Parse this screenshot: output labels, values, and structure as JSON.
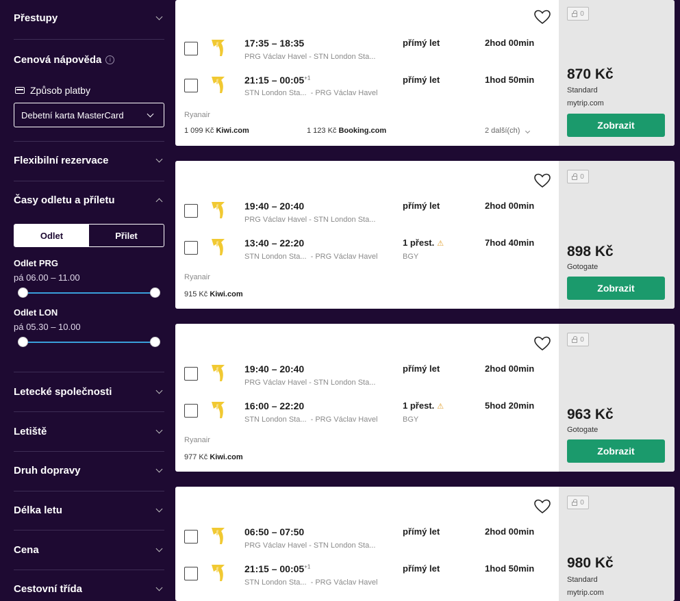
{
  "sidebar": {
    "prestupy": "Přestupy",
    "cenova_napoveda": "Cenová nápověda",
    "info": "i",
    "zpusob_platby": "Způsob platby",
    "payment_value": "Debetní karta MasterCard",
    "flexibilni": "Flexibilní rezervace",
    "casy": "Časy odletu a příletu",
    "toggle_odlet": "Odlet",
    "toggle_prilet": "Přilet",
    "odlet_prg_label": "Odlet PRG",
    "odlet_prg_value": "pá 06.00 – 11.00",
    "odlet_lon_label": "Odlet LON",
    "odlet_lon_value": "pá 05.30 – 10.00",
    "letecke": "Letecké společnosti",
    "letiste": "Letiště",
    "druh": "Druh dopravy",
    "delka": "Délka letu",
    "cena": "Cena",
    "trida": "Cestovní třída"
  },
  "cards": [
    {
      "legs": [
        {
          "times": "17:35 – 18:35",
          "plus": "",
          "from": "PRG Václav Havel",
          "to": "STN London Sta...",
          "stops": "přímý let",
          "via": "",
          "duration": "2hod 00min"
        },
        {
          "times": "21:15 – 00:05",
          "plus": "+1",
          "from": "STN London Sta...",
          "to": "PRG Václav Havel",
          "stops": "přímý let",
          "via": "",
          "duration": "1hod 50min"
        }
      ],
      "airline": "Ryanair",
      "alt1_price": "1 099 Kč",
      "alt1_site": "Kiwi.com",
      "alt2_price": "1 123 Kč",
      "alt2_site": "Booking.com",
      "more": "2 další(ch)",
      "lock": "0",
      "price": "870 Kč",
      "fare": "Standard",
      "provider": "mytrip.com",
      "button": "Zobrazit"
    },
    {
      "legs": [
        {
          "times": "19:40 – 20:40",
          "plus": "",
          "from": "PRG Václav Havel",
          "to": "STN London Sta...",
          "stops": "přímý let",
          "via": "",
          "duration": "2hod 00min"
        },
        {
          "times": "13:40 – 22:20",
          "plus": "",
          "from": "STN London Sta...",
          "to": "PRG Václav Havel",
          "stops": "1 přest.",
          "via": "BGY",
          "duration": "7hod 40min"
        }
      ],
      "airline": "Ryanair",
      "alt1_price": "915 Kč",
      "alt1_site": "Kiwi.com",
      "lock": "0",
      "price": "898 Kč",
      "fare": "Gotogate",
      "button": "Zobrazit"
    },
    {
      "legs": [
        {
          "times": "19:40 – 20:40",
          "plus": "",
          "from": "PRG Václav Havel",
          "to": "STN London Sta...",
          "stops": "přímý let",
          "via": "",
          "duration": "2hod 00min"
        },
        {
          "times": "16:00 – 22:20",
          "plus": "",
          "from": "STN London Sta...",
          "to": "PRG Václav Havel",
          "stops": "1 přest.",
          "via": "BGY",
          "duration": "5hod 20min"
        }
      ],
      "airline": "Ryanair",
      "alt1_price": "977 Kč",
      "alt1_site": "Kiwi.com",
      "lock": "0",
      "price": "963 Kč",
      "fare": "Gotogate",
      "button": "Zobrazit"
    },
    {
      "legs": [
        {
          "times": "06:50 – 07:50",
          "plus": "",
          "from": "PRG Václav Havel",
          "to": "STN London Sta...",
          "stops": "přímý let",
          "via": "",
          "duration": "2hod 00min"
        },
        {
          "times": "21:15 – 00:05",
          "plus": "+1",
          "from": "STN London Sta...",
          "to": "PRG Václav Havel",
          "stops": "přímý let",
          "via": "",
          "duration": "1hod 50min"
        }
      ],
      "lock": "0",
      "price": "980 Kč",
      "fare": "Standard",
      "provider": "mytrip.com"
    }
  ],
  "colors": {
    "sidebar_bg": "#1e0a32",
    "button_green": "#1b9a6c",
    "slider_blue": "#3aa0dc",
    "logo_yellow": "#f1c932"
  }
}
